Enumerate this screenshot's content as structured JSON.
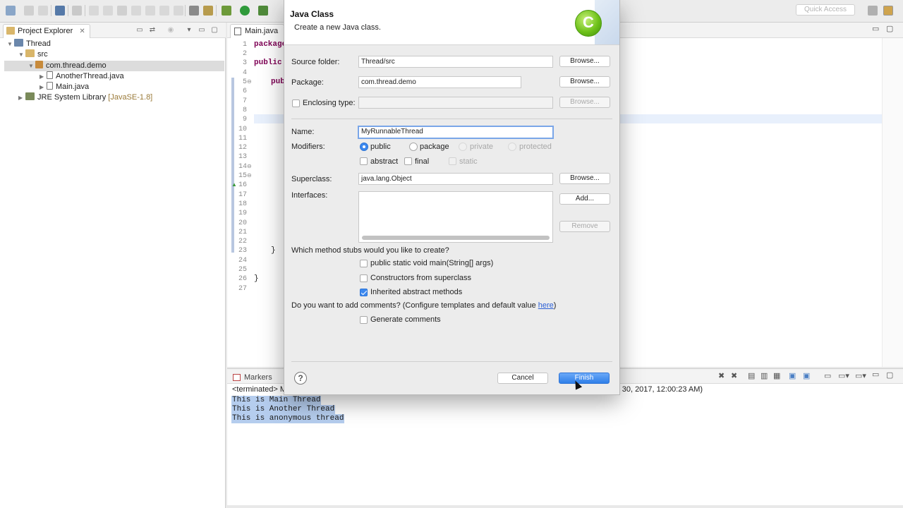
{
  "toolbar": {
    "quick_access_placeholder": "Quick Access"
  },
  "explorer": {
    "tab_label": "Project Explorer",
    "close": "✕",
    "tree": [
      {
        "label": "Thread",
        "icon": "project-folder-icon"
      },
      {
        "label": "src",
        "icon": "source-folder-icon"
      },
      {
        "label": "com.thread.demo",
        "icon": "package-icon"
      },
      {
        "label": "AnotherThread.java",
        "icon": "java-file-icon"
      },
      {
        "label": "Main.java",
        "icon": "java-file-icon"
      },
      {
        "label": "JRE System Library",
        "suffix": "[JavaSE-1.8]",
        "icon": "library-icon"
      }
    ]
  },
  "editor": {
    "tab_label": "Main.java",
    "line_numbers": [
      "1",
      "2",
      "3",
      "4",
      "5",
      "6",
      "7",
      "8",
      "9",
      "10",
      "11",
      "12",
      "13",
      "14",
      "15",
      "16",
      "17",
      "18",
      "19",
      "20",
      "21",
      "22",
      "23",
      "24",
      "25",
      "26",
      "27"
    ],
    "code": {
      "line1": "package",
      "line3": "public",
      "line5": "pub",
      "line23": "}",
      "line26": "}"
    }
  },
  "console": {
    "tab_label": "Markers",
    "status_prefix": "<terminated> M",
    "status_suffix": "r 30, 2017, 12:00:23 AM)",
    "output": [
      "This is Main Thread",
      "This is Another Thread",
      "This is anonymous thread"
    ]
  },
  "dialog": {
    "title": "Java Class",
    "subtitle": "Create a new Java class.",
    "source_folder_label": "Source folder:",
    "source_folder_value": "Thread/src",
    "package_label": "Package:",
    "package_value": "com.thread.demo",
    "enclosing_type_label": "Enclosing type:",
    "enclosing_type_value": "",
    "browse_label": "Browse...",
    "name_label": "Name:",
    "name_value": "MyRunnableThread",
    "modifiers_label": "Modifiers:",
    "modifiers": {
      "public": "public",
      "package": "package",
      "private": "private",
      "protected": "protected",
      "abstract": "abstract",
      "final": "final",
      "static": "static"
    },
    "superclass_label": "Superclass:",
    "superclass_value": "java.lang.Object",
    "interfaces_label": "Interfaces:",
    "add_label": "Add...",
    "remove_label": "Remove",
    "stubs_question": "Which method stubs would you like to create?",
    "stub_main": "public static void main(String[] args)",
    "stub_constructors": "Constructors from superclass",
    "stub_inherited": "Inherited abstract methods",
    "comments_question": "Do you want to add comments? (Configure templates and default value ",
    "comments_link": "here",
    "comments_close": ")",
    "generate_comments": "Generate comments",
    "help": "?",
    "cancel_label": "Cancel",
    "finish_label": "Finish",
    "graphic_letter": "C"
  },
  "colors": {
    "accent": "#3c88ef",
    "console_highlight": "#b5cdee",
    "keyword": "#7f0055"
  }
}
